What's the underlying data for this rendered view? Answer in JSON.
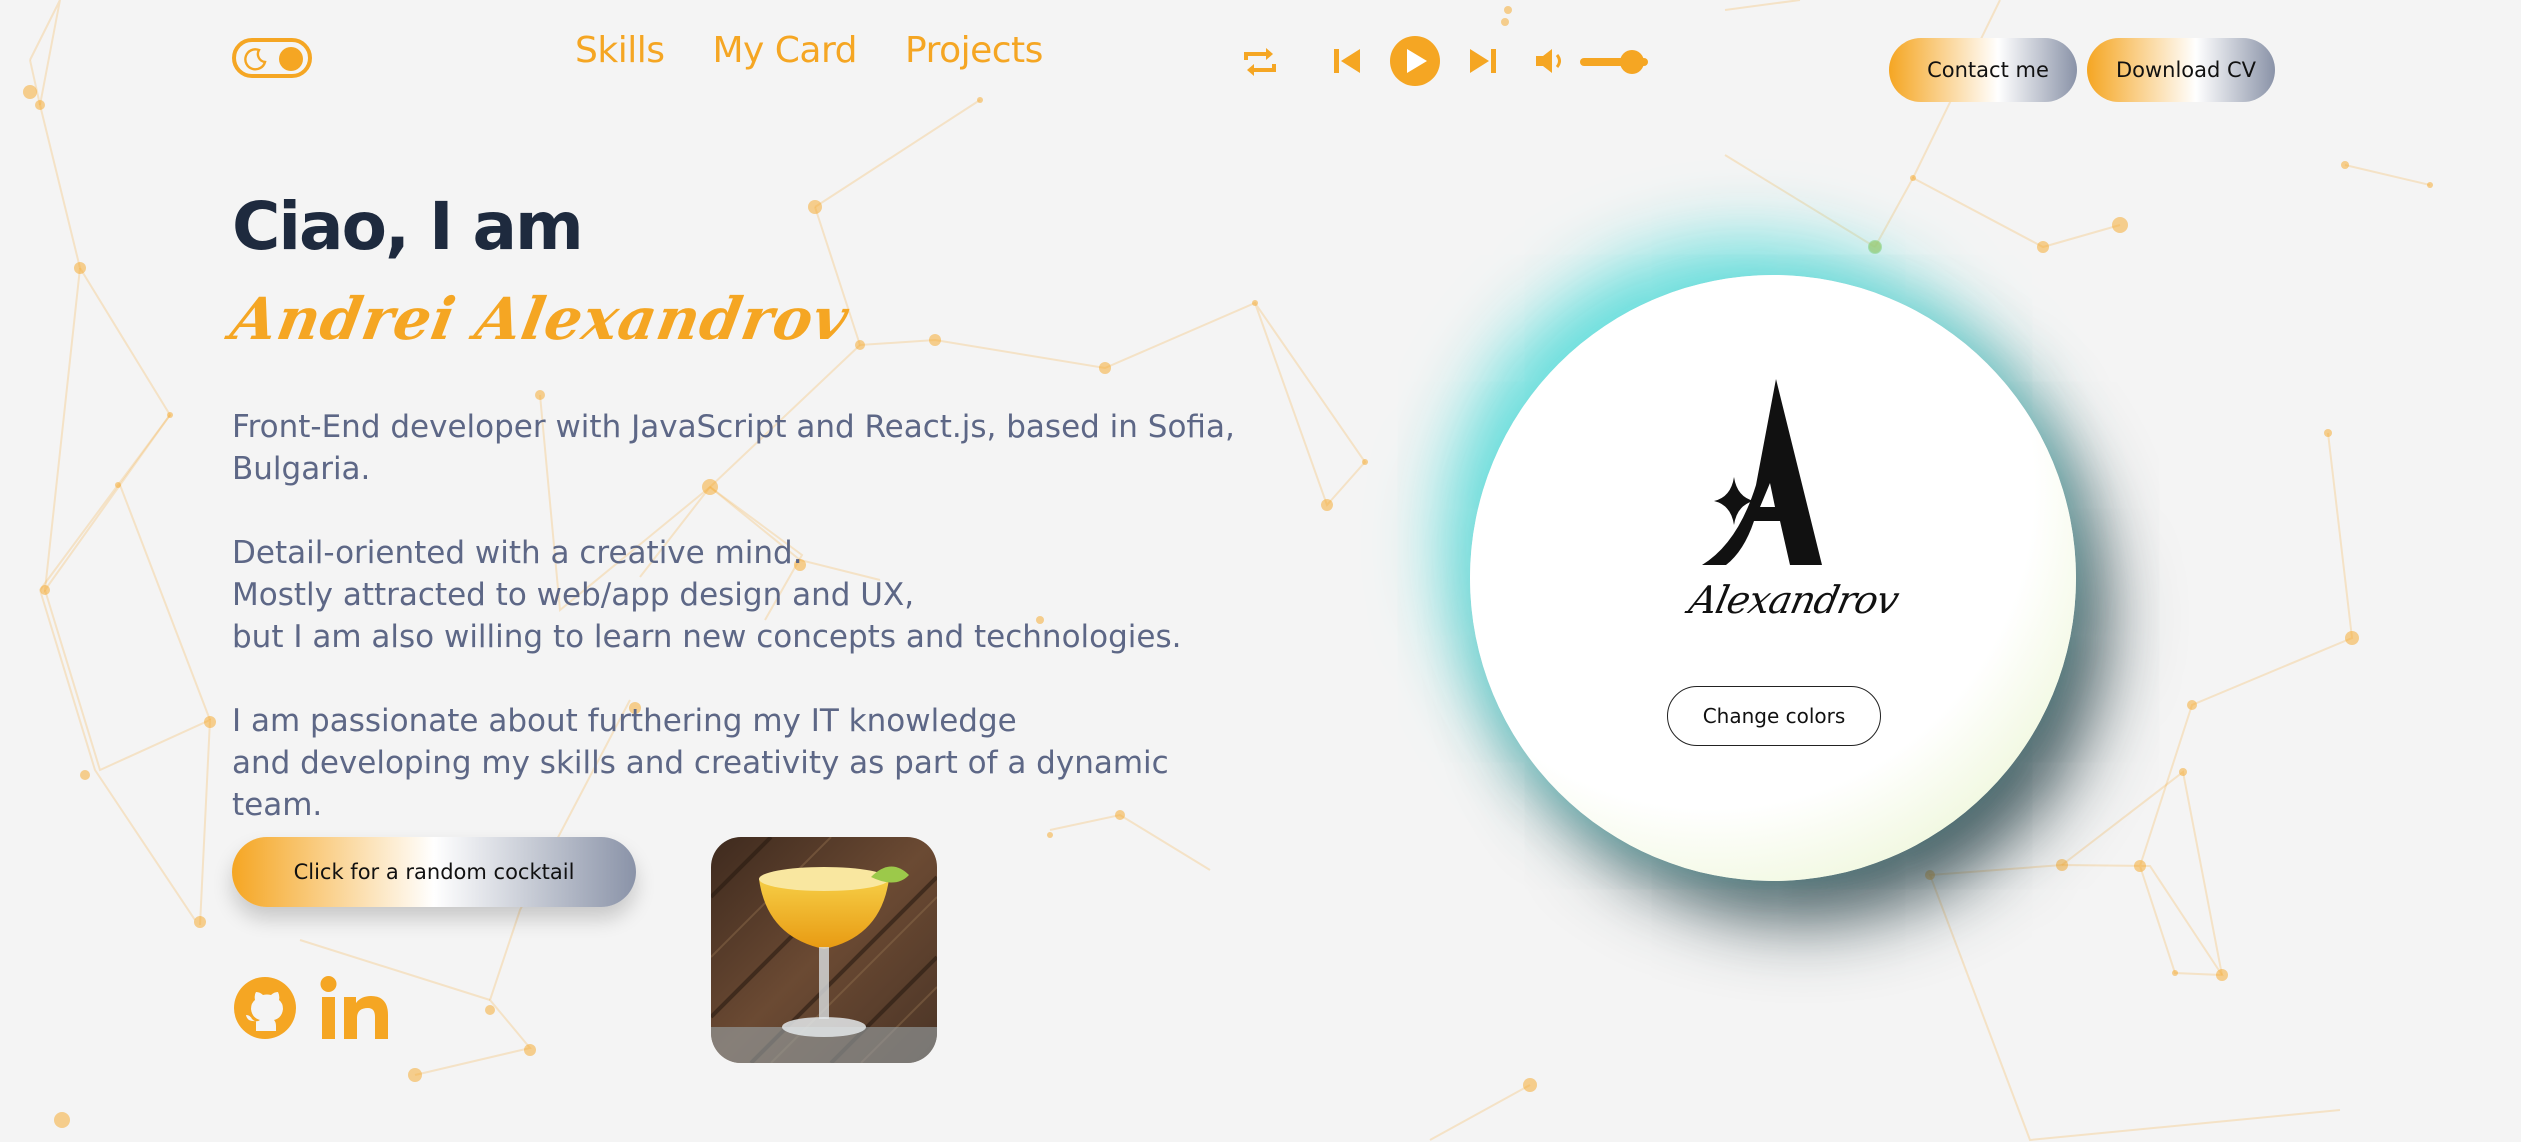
{
  "theme_toggle": {
    "mode": "light",
    "icon": "moon-icon"
  },
  "nav": {
    "items": [
      "Skills",
      "My Card",
      "Projects"
    ]
  },
  "player": {
    "icons": [
      "repeat-icon",
      "previous-icon",
      "play-icon",
      "next-icon",
      "volume-icon"
    ],
    "volume_level": 0.7
  },
  "header_buttons": {
    "contact": "Contact me",
    "download_cv": "Download CV"
  },
  "hero": {
    "greeting": "Ciao, I am",
    "name": "Andrei Alexandrov",
    "bio": [
      "Front-End developer with JavaScript and React.js, based in Sofia,",
      "Bulgaria.",
      "",
      "Detail-oriented with a creative mind.",
      "Mostly attracted to web/app design and UX,",
      "but I am also willing to learn new concepts and technologies.",
      "",
      "I am passionate about furthering my IT knowledge",
      "and developing my skills and creativity as part of a dynamic team."
    ],
    "cocktail_button": "Click for a random cocktail"
  },
  "social": {
    "icons": [
      "github-icon",
      "linkedin-icon"
    ]
  },
  "card": {
    "logo_signature": "Alexandrov",
    "change_colors_label": "Change colors"
  },
  "colors": {
    "accent": "#f5a623",
    "heading": "#1e2a3e",
    "body_text": "#5d6786",
    "background": "#f4f4f4",
    "glow_cyan": "#60dedc",
    "glow_green": "#8ef03a"
  }
}
